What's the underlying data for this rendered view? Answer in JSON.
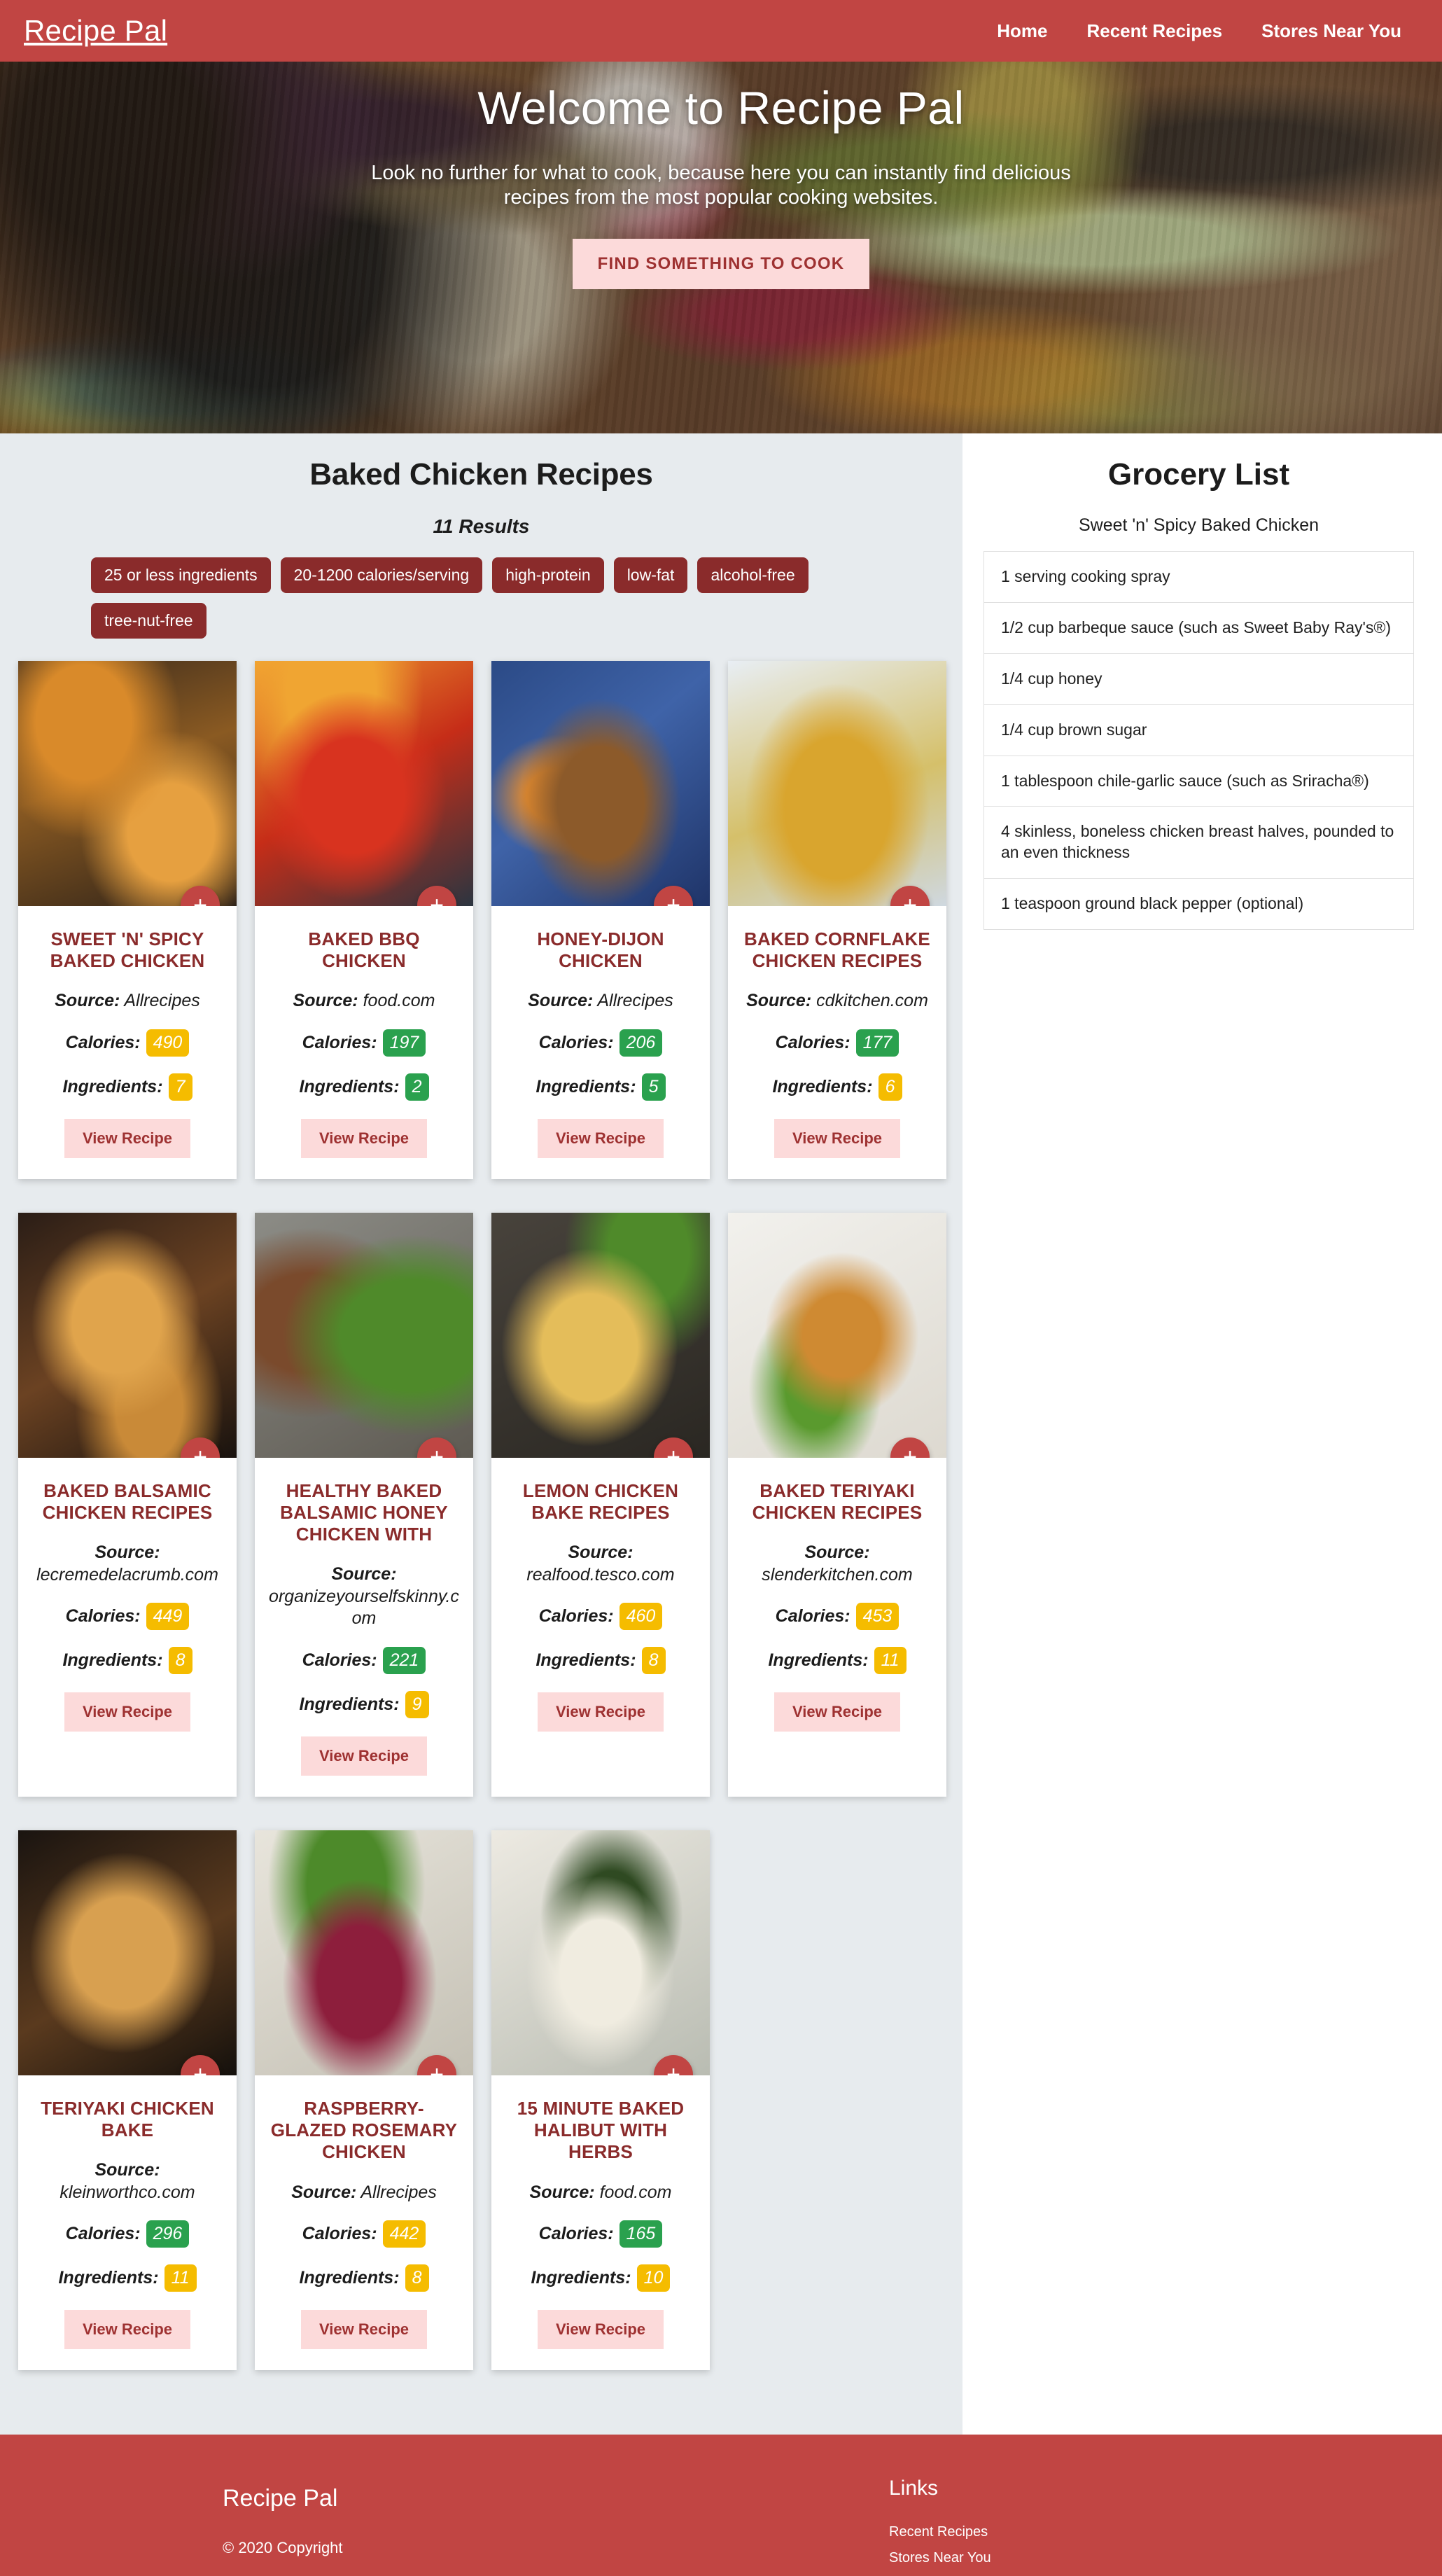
{
  "navbar": {
    "brand": "Recipe Pal",
    "links": [
      {
        "label": "Home"
      },
      {
        "label": "Recent Recipes"
      },
      {
        "label": "Stores Near You"
      }
    ]
  },
  "hero": {
    "title": "Welcome to Recipe Pal",
    "subtitle": "Look no further for what to cook, because here you can instantly find delicious recipes from the most popular cooking websites.",
    "cta_label": "FIND SOMETHING TO COOK"
  },
  "results": {
    "title": "Baked Chicken Recipes",
    "count_label": "11 Results",
    "filters": [
      {
        "label": "25 or less ingredients"
      },
      {
        "label": "20-1200 calories/serving"
      },
      {
        "label": "high-protein"
      },
      {
        "label": "low-fat"
      },
      {
        "label": "alcohol-free"
      },
      {
        "label": "tree-nut-free"
      }
    ],
    "source_prefix": "Source:",
    "calories_label": "Calories:",
    "ingredients_label": "Ingredients:",
    "view_label": "View Recipe",
    "add_icon": "+",
    "cards": [
      {
        "title": "Sweet 'n' Spicy Baked Chicken",
        "source": "Allrecipes",
        "calories": "490",
        "calories_color": "yellow",
        "ingredients": "7",
        "ingredients_color": "yellow",
        "source_inline": true
      },
      {
        "title": "Baked BBQ Chicken",
        "source": "food.com",
        "calories": "197",
        "calories_color": "green",
        "ingredients": "2",
        "ingredients_color": "green",
        "source_inline": true
      },
      {
        "title": "Honey-Dijon Chicken",
        "source": "Allrecipes",
        "calories": "206",
        "calories_color": "green",
        "ingredients": "5",
        "ingredients_color": "green",
        "source_inline": true
      },
      {
        "title": "Baked Cornflake Chicken Recipes",
        "source": "cdkitchen.com",
        "calories": "177",
        "calories_color": "green",
        "ingredients": "6",
        "ingredients_color": "yellow",
        "source_inline": true
      },
      {
        "title": "Baked Balsamic Chicken Recipes",
        "source": "lecremedelacrumb.com",
        "calories": "449",
        "calories_color": "yellow",
        "ingredients": "8",
        "ingredients_color": "yellow",
        "source_inline": false
      },
      {
        "title": "Healthy Baked Balsamic Honey Chicken With",
        "source": "organizeyourselfskinny.com",
        "calories": "221",
        "calories_color": "green",
        "ingredients": "9",
        "ingredients_color": "yellow",
        "source_inline": false
      },
      {
        "title": "Lemon Chicken Bake Recipes",
        "source": "realfood.tesco.com",
        "calories": "460",
        "calories_color": "yellow",
        "ingredients": "8",
        "ingredients_color": "yellow",
        "source_inline": false
      },
      {
        "title": "Baked Teriyaki Chicken Recipes",
        "source": "slenderkitchen.com",
        "calories": "453",
        "calories_color": "yellow",
        "ingredients": "11",
        "ingredients_color": "yellow",
        "source_inline": false
      },
      {
        "title": "Teriyaki Chicken Bake",
        "source": "kleinworthco.com",
        "calories": "296",
        "calories_color": "green",
        "ingredients": "11",
        "ingredients_color": "yellow",
        "source_inline": true
      },
      {
        "title": "Raspberry-Glazed Rosemary Chicken",
        "source": "Allrecipes",
        "calories": "442",
        "calories_color": "yellow",
        "ingredients": "8",
        "ingredients_color": "yellow",
        "source_inline": true
      },
      {
        "title": "15 Minute Baked Halibut With Herbs",
        "source": "food.com",
        "calories": "165",
        "calories_color": "green",
        "ingredients": "10",
        "ingredients_color": "yellow",
        "source_inline": true
      }
    ]
  },
  "grocery": {
    "title": "Grocery List",
    "recipe_name": "Sweet 'n' Spicy Baked Chicken",
    "items": [
      "1 serving cooking spray",
      "1/2 cup barbeque sauce (such as Sweet Baby Ray's®)",
      "1/4 cup honey",
      "1/4 cup brown sugar",
      "1 tablespoon chile-garlic sauce (such as Sriracha®)",
      "4 skinless, boneless chicken breast halves, pounded to an even thickness",
      "1 teaspoon ground black pepper (optional)"
    ]
  },
  "footer": {
    "brand": "Recipe Pal",
    "copyright": "© 2020 Copyright",
    "links_heading": "Links",
    "links": [
      {
        "label": "Recent Recipes"
      },
      {
        "label": "Stores Near You"
      }
    ]
  },
  "colors": {
    "brand_red": "#c14543",
    "dark_red": "#8a2b2b",
    "pink_button": "#fcdada",
    "green_badge": "#2aa14e",
    "yellow_badge": "#f5bc00",
    "page_bg": "#e7ebee"
  }
}
